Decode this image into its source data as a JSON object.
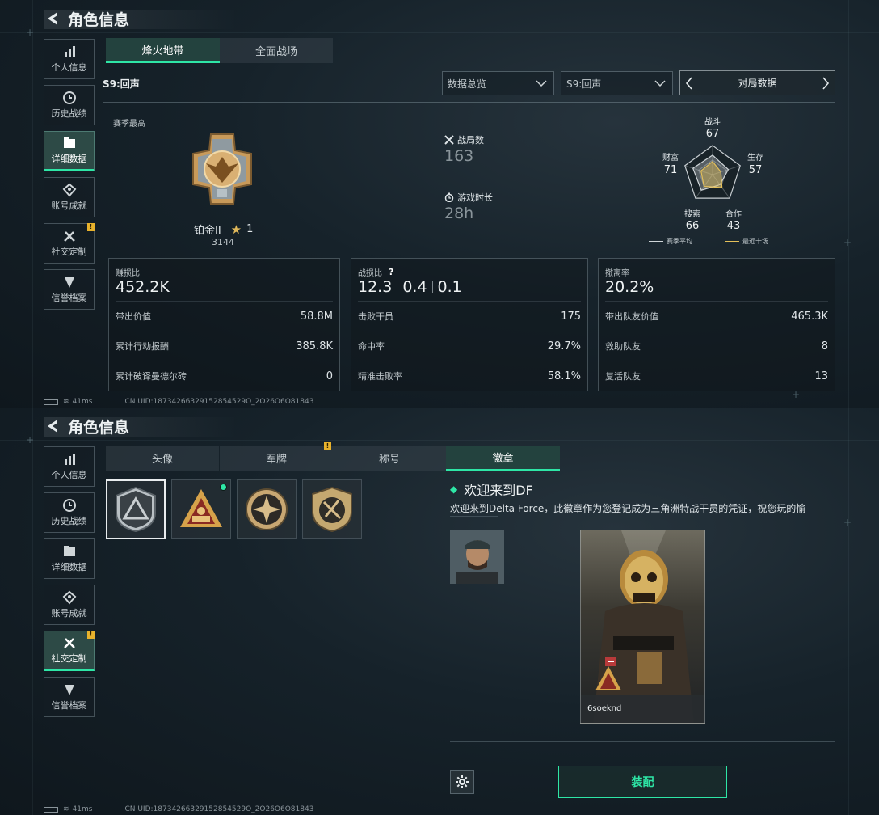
{
  "screen_top": {
    "title": "角色信息",
    "nav": [
      {
        "label": "个人信息",
        "icon": "bar-chart-icon"
      },
      {
        "label": "历史战绩",
        "icon": "history-clock-icon"
      },
      {
        "label": "详细数据",
        "icon": "folder-icon",
        "active": true
      },
      {
        "label": "账号成就",
        "icon": "achievement-icon"
      },
      {
        "label": "社交定制",
        "icon": "tools-icon",
        "badge": "!"
      },
      {
        "label": "信誉档案",
        "icon": "reputation-icon"
      }
    ],
    "mode_tabs": [
      {
        "label": "烽火地带",
        "active": true
      },
      {
        "label": "全面战场",
        "active": false
      }
    ],
    "season_label": "S9:回声",
    "filter_overview": "数据总览",
    "filter_season": "S9:回声",
    "pager_label": "对局数据",
    "season_best": {
      "label": "赛季最高",
      "rank_name": "铂金II",
      "stars": "1",
      "score": "3144"
    },
    "matches": {
      "label": "战局数",
      "value": "163"
    },
    "playtime": {
      "label": "游戏时长",
      "value": "28h"
    },
    "radar": {
      "labels": {
        "combat": "战斗",
        "survival": "生存",
        "teamwork": "合作",
        "search": "搜索",
        "wealth": "财富"
      },
      "values": {
        "combat": 67,
        "survival": 57,
        "teamwork": 43,
        "search": 66,
        "wealth": 71
      },
      "recent": {
        "combat": 45,
        "survival": 30,
        "teamwork": 55,
        "search": 50,
        "wealth": 42
      },
      "legend_avg": "赛季平均",
      "legend_recent": "最近十场",
      "colors": {
        "avg": "#cfd5d8",
        "recent": "#e4c05a"
      }
    },
    "boxes": [
      {
        "head": "赚损比",
        "big": "452.2K",
        "rows": [
          {
            "k": "带出价值",
            "v": "58.8M"
          },
          {
            "k": "累计行动报酬",
            "v": "385.8K"
          },
          {
            "k": "累计破译曼德尔砖",
            "v": "0"
          }
        ]
      },
      {
        "head": "战损比",
        "big_a": "12.3",
        "big_b": "0.4",
        "big_c": "0.1",
        "help": "?",
        "rows": [
          {
            "k": "击败干员",
            "v": "175"
          },
          {
            "k": "命中率",
            "v": "29.7%"
          },
          {
            "k": "精准击败率",
            "v": "58.1%"
          }
        ]
      },
      {
        "head": "撤离率",
        "big": "20.2%",
        "rows": [
          {
            "k": "带出队友价值",
            "v": "465.3K"
          },
          {
            "k": "救助队友",
            "v": "8"
          },
          {
            "k": "复活队友",
            "v": "13"
          }
        ]
      }
    ],
    "status": {
      "ping": "41ms",
      "uid": "CN UID:18734266329152854529O_2O26O6O81843"
    }
  },
  "screen_bottom": {
    "title": "角色信息",
    "nav": [
      {
        "label": "个人信息"
      },
      {
        "label": "历史战绩"
      },
      {
        "label": "详细数据"
      },
      {
        "label": "账号成就"
      },
      {
        "label": "社交定制",
        "active": true,
        "badge": "!"
      },
      {
        "label": "信誉档案"
      }
    ],
    "tabs": [
      {
        "label": "头像",
        "active": false
      },
      {
        "label": "军牌",
        "active": false,
        "badge": "!"
      },
      {
        "label": "称号",
        "active": false
      },
      {
        "label": "徽章",
        "active": true
      }
    ],
    "badge_title": "欢迎来到DF",
    "badge_desc": "欢迎来到Delta Force，此徽章作为您登记成为三角洲特战干员的凭证，祝您玩的愉",
    "player_name": "6soeknd",
    "equip_label": "装配",
    "status": {
      "ping": "41ms",
      "uid": "CN UID:18734266329152854529O_2O26O6O81843"
    }
  }
}
